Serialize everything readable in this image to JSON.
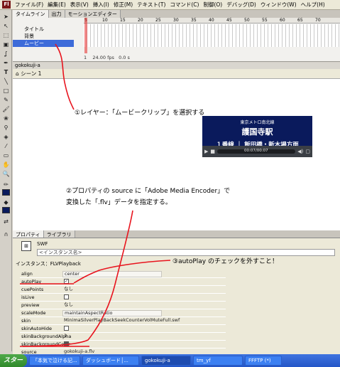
{
  "menu": {
    "app_icon": "Fl",
    "items": [
      "ファイル(F)",
      "編集(E)",
      "表示(V)",
      "挿入(I)",
      "修正(M)",
      "テキスト(T)",
      "コマンド(C)",
      "制御(O)",
      "デバッグ(D)",
      "ウィンドウ(W)",
      "ヘルプ(H)"
    ]
  },
  "timeline": {
    "tabs": [
      "タイムライン",
      "出力",
      "モーションエディター"
    ],
    "layers": [
      "タイトル",
      "背景",
      "ムービー"
    ],
    "frame_ticks": [
      "5",
      "10",
      "15",
      "20",
      "25",
      "30",
      "35",
      "40",
      "45",
      "50",
      "55",
      "60",
      "65",
      "70"
    ],
    "status": [
      "1",
      "24.00 fps",
      "0.0 s"
    ]
  },
  "stage": {
    "doc_tab": "gokokuji-a",
    "crumb": "シーン 1"
  },
  "video": {
    "line1": "東京メトロ南北線",
    "line2": "護国寺駅",
    "line3": "１番線 ｜ 飯田橋・新木場方面",
    "time": "00:07/00:07"
  },
  "annotations": {
    "note1": "①レイヤー：「ムービークリップ」を選択する",
    "note2a": "②プロパティの source に「Adobe Media Encoder」で",
    "note2b": "変換した「.flv」データを指定する。",
    "note3": "③autoPlay のチェックを外すこと！"
  },
  "properties": {
    "tabs": [
      "プロパティ",
      "ライブラリ"
    ],
    "symbol_type": "SWF",
    "instance_placeholder": "<インスタンス名>",
    "instance_label": "インスタンス：FLVPlayback",
    "params": [
      {
        "key": "align",
        "value": "center"
      },
      {
        "key": "autoPlay",
        "value": "✓",
        "checkbox": true
      },
      {
        "key": "cuePoints",
        "value": "なし"
      },
      {
        "key": "isLive",
        "value": "",
        "checkbox": true
      },
      {
        "key": "preview",
        "value": "なし"
      },
      {
        "key": "scaleMode",
        "value": "maintainAspectRatio"
      },
      {
        "key": "skin",
        "value": "MinimaSilverPlayBackSeekCounterVolMuteFull.swf"
      },
      {
        "key": "skinAutoHide",
        "value": "",
        "checkbox": true
      },
      {
        "key": "skinBackgroundAlpha",
        "value": "1"
      },
      {
        "key": "skinBackgroundColor",
        "value": "",
        "checkbox": true
      },
      {
        "key": "source",
        "value": "gokokuji-a.flv"
      },
      {
        "key": "volume",
        "value": "1"
      }
    ]
  },
  "taskbar": {
    "start": "スタート",
    "buttons": [
      "「本気で泣ける記...",
      "ダッシュボード│...",
      "gokokuji-a",
      "tm_yf",
      "FFFTP (*)"
    ]
  },
  "colors": {
    "annotation_line": "#e8141e",
    "selected_layer": "#3d6bd9",
    "video_bg": "#0a1a5c"
  }
}
